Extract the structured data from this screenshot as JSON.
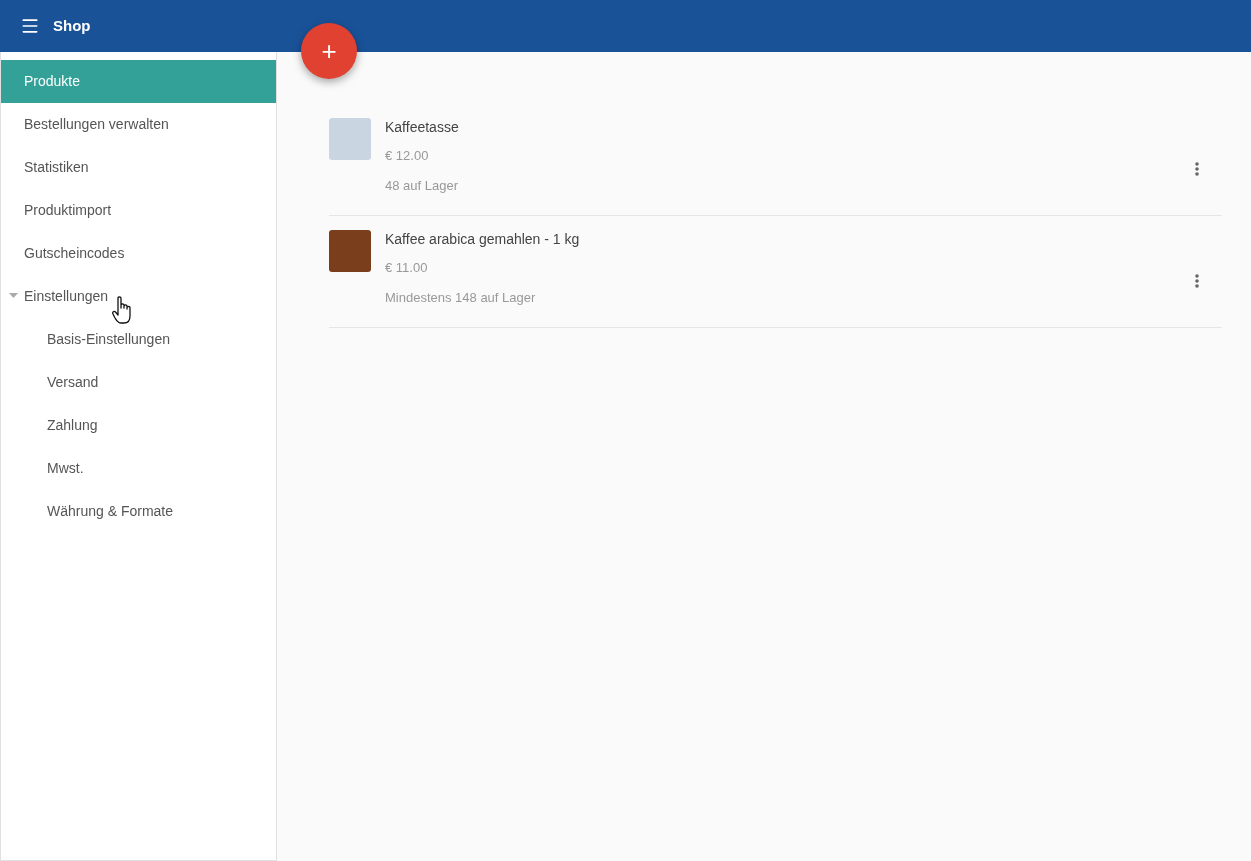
{
  "app_bar": {
    "title": "Shop"
  },
  "add_button": {
    "label": "+"
  },
  "sidebar": {
    "items": [
      {
        "label": "Produkte",
        "selected": true
      },
      {
        "label": "Bestellungen verwalten",
        "selected": false
      },
      {
        "label": "Statistiken",
        "selected": false
      },
      {
        "label": "Produktimport",
        "selected": false
      },
      {
        "label": "Gutscheincodes",
        "selected": false
      },
      {
        "label": "Einstellungen",
        "selected": false,
        "expanded": true,
        "children": [
          {
            "label": "Basis-Einstellungen",
            "selected": false
          },
          {
            "label": "Versand",
            "selected": false
          },
          {
            "label": "Zahlung",
            "selected": false
          },
          {
            "label": "Mwst.",
            "selected": false
          },
          {
            "label": "Währung & Formate",
            "selected": false
          }
        ]
      }
    ]
  },
  "products": [
    {
      "name": "Kaffeetasse",
      "price": "€ 12.00",
      "stock": "48 auf Lager"
    },
    {
      "name": "Kaffee arabica gemahlen - 1 kg",
      "price": "€ 11.00",
      "stock": "Mindestens 148 auf Lager"
    }
  ]
}
